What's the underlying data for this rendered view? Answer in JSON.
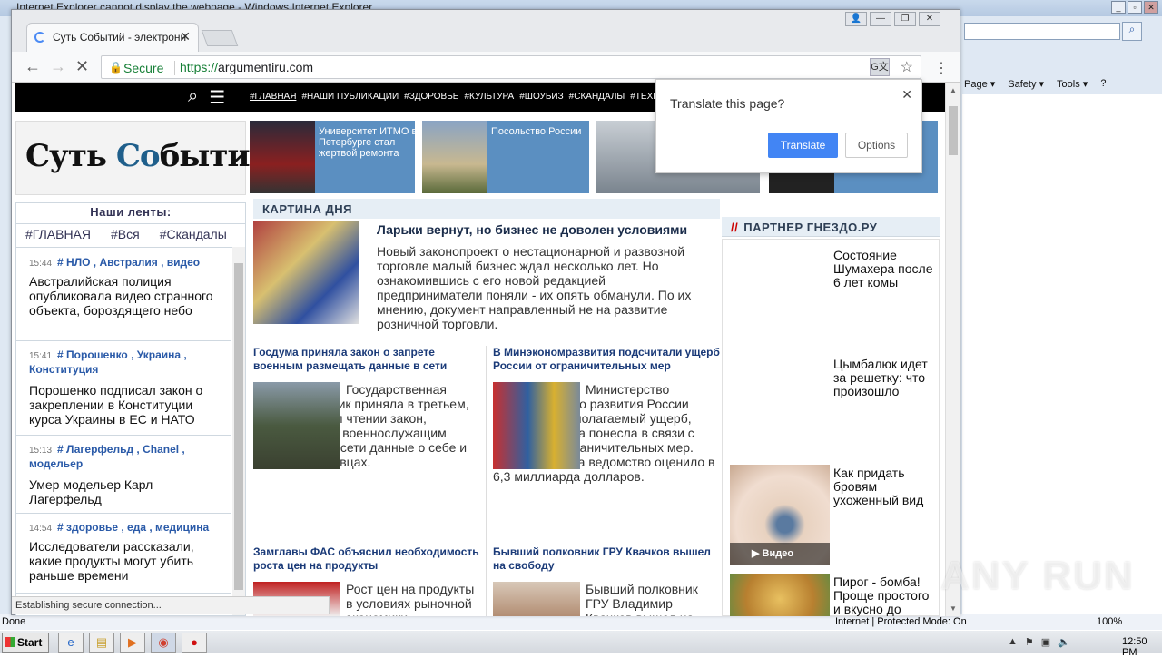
{
  "ie": {
    "title": "Internet Explorer cannot display the webpage - Windows Internet Explorer",
    "commands": [
      "Page ▾",
      "Safety ▾",
      "Tools ▾",
      "?"
    ],
    "status_done": "Done",
    "protected_mode": "Internet | Protected Mode: On",
    "zoom": "100%"
  },
  "chrome": {
    "tab_title": "Суть Событий - электронн",
    "secure_label": "Secure",
    "url_scheme": "https://",
    "url_host": "argumentiru.com",
    "status": "Establishing secure connection..."
  },
  "translate_popup": {
    "question": "Translate this page?",
    "translate_label": "Translate",
    "options_label": "Options"
  },
  "site": {
    "logo_a": "Суть ",
    "logo_b": "Со",
    "logo_c": "бытий",
    "nav": [
      "#ГЛАВНАЯ",
      "#НАШИ ПУБЛИКАЦИИ",
      "#ЗДОРОВЬЕ",
      "#КУЛЬТУРА",
      "#ШОУБИЗ",
      "#СКАНДАЛЫ",
      "#ТЕХНО"
    ],
    "promos": [
      {
        "text": "Университет ИТМО в Петербурге стал жертвой ремонта"
      },
      {
        "text": "Посольство России"
      }
    ],
    "feeds_header": "Наши ленты:",
    "feed_tabs": [
      "#ГЛАВНАЯ",
      "#Вся",
      "#Скандалы"
    ],
    "feed": [
      {
        "time": "15:44",
        "tags": "# НЛО , Австралия , видео",
        "text": "Австралийская полиция опубликовала видео странного объекта, бороздящего небо"
      },
      {
        "time": "15:41",
        "tags": "# Порошенко , Украина , Конституция",
        "text": "Порошенко подписал закон о закреплении в Конституции курса Украины в ЕС и НАТО"
      },
      {
        "time": "15:13",
        "tags": "# Лагерфельд , Chanel , модельер",
        "text": "Умер модельер Карл Лагерфельд"
      },
      {
        "time": "14:54",
        "tags": "# здоровье , еда , медицина",
        "text": "Исследователи рассказали, какие продукты могут убить раньше времени"
      }
    ],
    "kartina_header": "КАРТИНА ДНЯ",
    "main_title": "Ларьки вернут, но бизнес не доволен условиями",
    "main_text": "Новый законопроект о нестационарной и развозной торговле малый бизнес ждал несколько лет. Но ознакомившись с его новой редакцией предприниматели поняли - их опять обманули. По их мнению, документ направленный не на развитие розничной торговли.",
    "articles": [
      {
        "title": "Госдума приняла закон о запрете военным размещать данные в сети",
        "text": "Государственная Дума во вторник приняла в третьем, окончательном чтении закон, запрещающий военнослужащим публиковать в сети данные о себе и своих сослуживцах."
      },
      {
        "title": "В Минэкономразвития подсчитали ущерб России от ограничительных мер",
        "text": "Министерство экономического развития России оценило предполагаемый ущерб, который страна понесла в связи с введением ограничительных мер. Размер ущерба ведомство оценило в 6,3 миллиарда долларов."
      },
      {
        "title": "Замглавы ФАС объяснил необходимость роста цен на продукты",
        "text": "Рост цен на продукты в условиях рыночной экономики"
      },
      {
        "title": "Бывший полковник ГРУ Квачков вышел на свободу",
        "text": "Бывший полковник ГРУ Владимир Квачков вышел на"
      }
    ],
    "partner_header": "ПАРТНЕР ГНЕЗДО.РУ",
    "partner_mark": "//",
    "partner_items": [
      "Состояние Шумахера после 6 лет комы",
      "Цымбалюк идет за решетку: что произошло",
      "Как придать бровям ухоженный вид",
      "Пирог - бомба! Проще простого и вкусно до безумия"
    ],
    "video_label": "▶  Видео"
  },
  "taskbar": {
    "start": "Start",
    "clock": "12:50 PM"
  },
  "watermark": "ANY RUN"
}
